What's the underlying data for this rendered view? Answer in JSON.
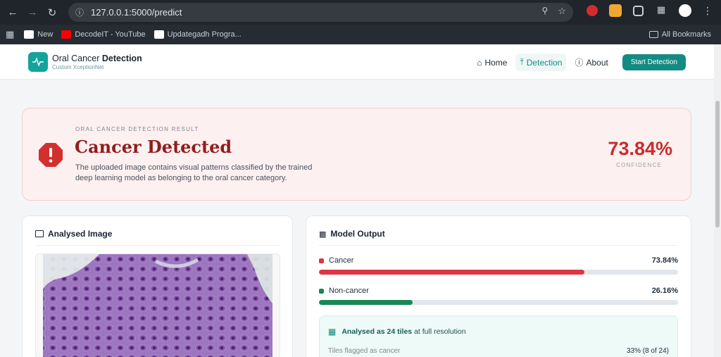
{
  "browser": {
    "url": "127.0.0.1:5000/predict",
    "bookmarks": [
      {
        "label": "New",
        "icon": "ug-logo-icon",
        "color": "#ffffff"
      },
      {
        "label": "DecodeIT - YouTube",
        "icon": "youtube-icon",
        "color": "#ff0000"
      },
      {
        "label": "Updategadh Progra...",
        "icon": "ug-logo-icon",
        "color": "#ffffff"
      }
    ],
    "all_bookmarks": "All Bookmarks"
  },
  "header": {
    "brand_light": "Oral Cancer ",
    "brand_bold": "Detection",
    "brand_sub": "Custom XceptionNet",
    "nav": {
      "home": "Home",
      "detection": "Detection",
      "about": "About"
    },
    "cta": "Start Detection"
  },
  "result": {
    "label": "ORAL CANCER DETECTION RESULT",
    "title": "Cancer Detected",
    "description": "The uploaded image contains visual patterns classified by the trained deep learning model as belonging to the oral cancer category.",
    "confidence": "73.84%",
    "confidence_label": "CONFIDENCE"
  },
  "analysed": {
    "title": "Analysed Image"
  },
  "model_output": {
    "title": "Model Output",
    "bars": [
      {
        "label": "Cancer",
        "value_text": "73.84%",
        "fraction": 0.7384,
        "color": "#dc3545"
      },
      {
        "label": "Non-cancer",
        "value_text": "26.16%",
        "fraction": 0.2616,
        "color": "#198754"
      }
    ],
    "tiles": {
      "bold": "Analysed as 24 tiles",
      "rest": " at full resolution",
      "row_label": "Tiles flagged as cancer",
      "row_value": "33% (8 of 24)"
    }
  },
  "colors": {
    "accent": "#138b83",
    "danger_title": "#8f1d1d",
    "confidence": "#c92c2c"
  }
}
